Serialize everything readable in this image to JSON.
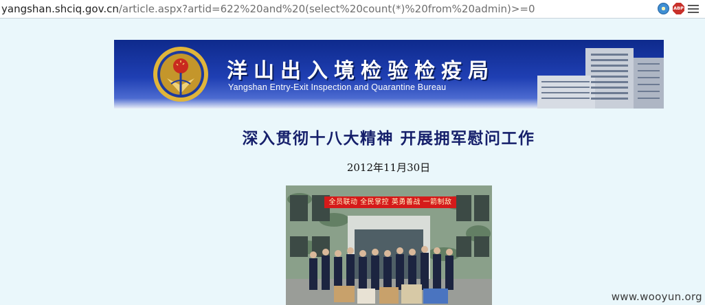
{
  "browser": {
    "url_host": "yangshan.shciq.gov.cn",
    "url_path": "/article.aspx?artid=622%20and%20(select%20count(*)%20from%20admin)>=0",
    "extensions": [
      "flower-extension-icon",
      "adblock-plus-icon",
      "menu-icon"
    ],
    "abp_label": "ABP"
  },
  "banner": {
    "title_cn": "洋山出入境检验检疫局",
    "title_en": "Yangshan Entry-Exit Inspection and Quarantine Bureau",
    "background_color": "#1f3fb3"
  },
  "article": {
    "title": "深入贯彻十八大精神 开展拥军慰问工作",
    "date": "2012年11月30日",
    "title_color": "#16206b"
  },
  "photo": {
    "banner_text": "全员联动 全民掌控 英勇善战 一箭制敌"
  },
  "watermark": "www.wooyun.org"
}
